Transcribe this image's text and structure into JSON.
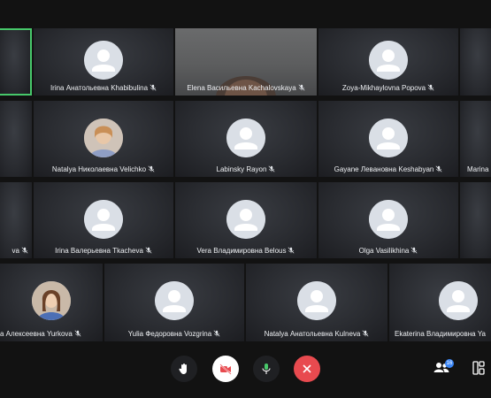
{
  "participants": {
    "row1": [
      {
        "name": ""
      },
      {
        "name": "Irina Анатольевна Khabibulina"
      },
      {
        "name": "Elena Васильевна Kachalovskaya"
      },
      {
        "name": "Zoya-Mikhaylovna Popova"
      }
    ],
    "row2": [
      {
        "name": "Natalya Николаевна Velichko"
      },
      {
        "name": "Labinsky Rayon"
      },
      {
        "name": "Gayane Левановна Keshabyan"
      },
      {
        "name": "Marina"
      }
    ],
    "row3": [
      {
        "name": "va"
      },
      {
        "name": "Irina Валерьевна Tkacheva"
      },
      {
        "name": "Vera Владимировна Belous"
      },
      {
        "name": "Olga Vasilikhina"
      }
    ],
    "row4": [
      {
        "name": "a Алексеевна Yurkova"
      },
      {
        "name": "Yulia Федоровна Vozgrina"
      },
      {
        "name": "Natalya Анатольевна Kulneva"
      },
      {
        "name": "Ekaterina Владимировна Ya"
      }
    ]
  },
  "toolbar": {
    "participants_count": "16",
    "buttons": [
      "raise-hand",
      "camera-off",
      "microphone",
      "end-call",
      "participants",
      "layout"
    ]
  },
  "colors": {
    "active_border": "#47c86a",
    "end_call": "#e84a4f",
    "badge": "#3b86f6"
  }
}
